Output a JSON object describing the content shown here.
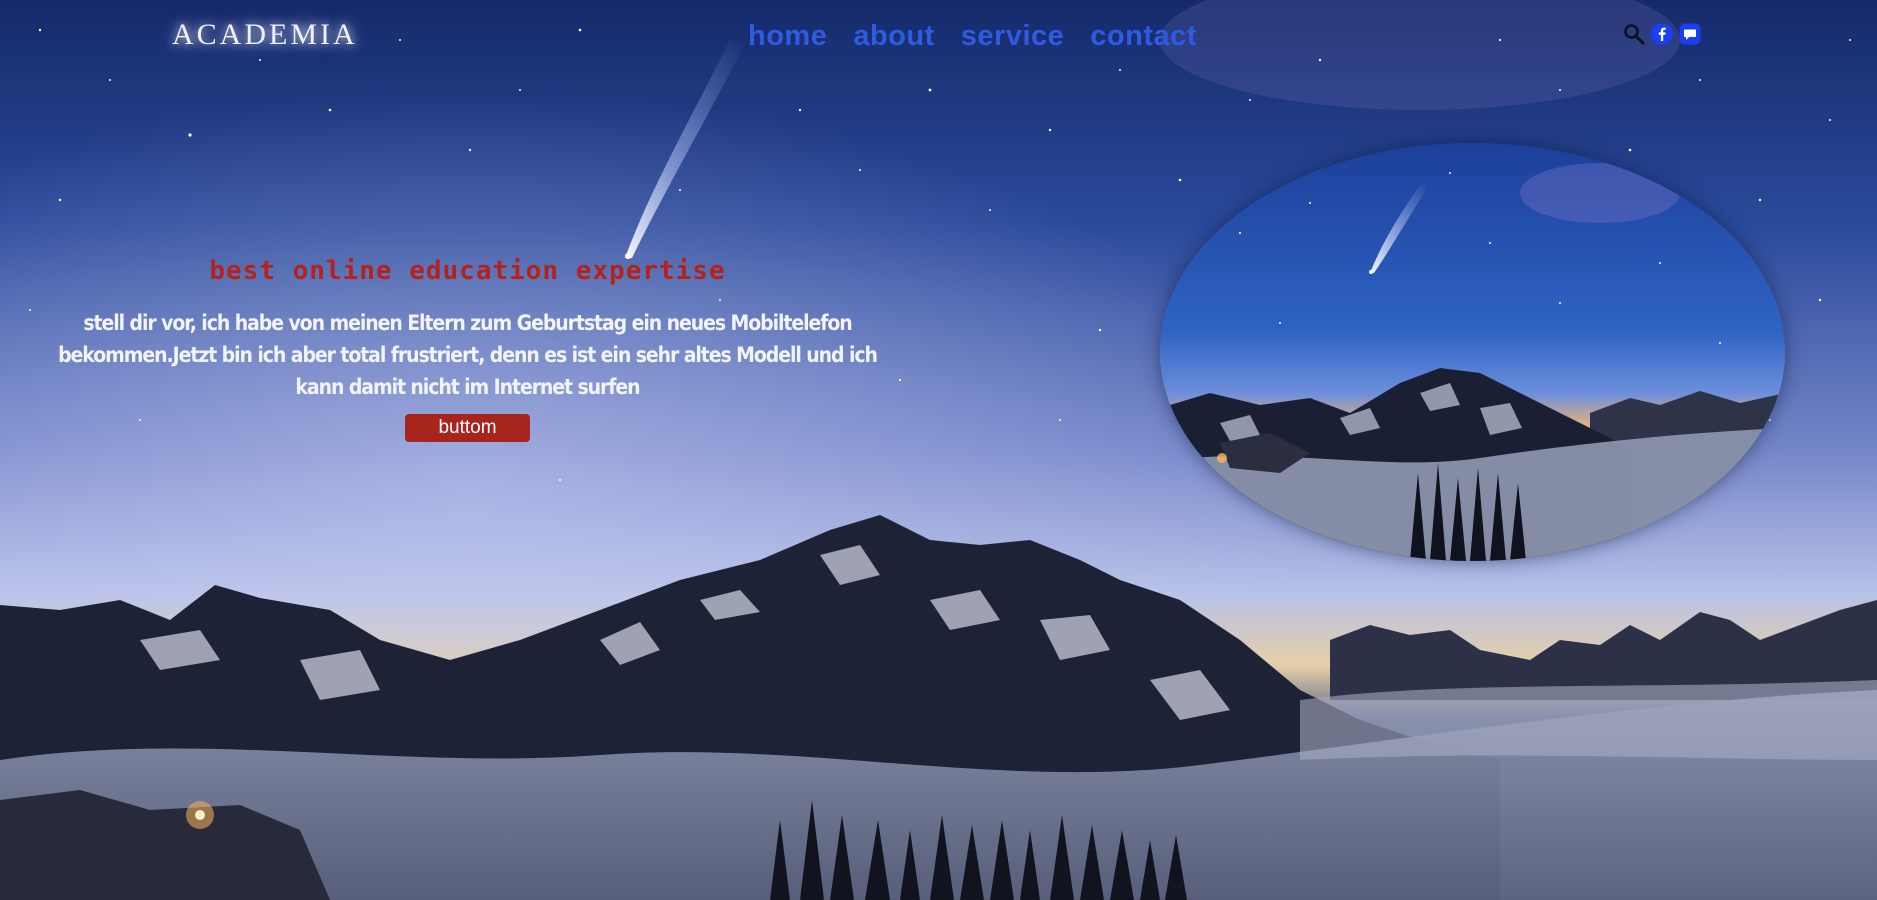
{
  "header": {
    "logo": "ACADEMIA",
    "nav": [
      {
        "label": "home"
      },
      {
        "label": "about"
      },
      {
        "label": "service"
      },
      {
        "label": "contact"
      }
    ],
    "icons": [
      "search-icon",
      "facebook-icon",
      "chat-icon"
    ]
  },
  "hero": {
    "tagline": "best online education expertise",
    "description": "stell dir vor, ich habe von meinen Eltern zum Geburtstag ein neues Mobiltelefon bekommen.Jetzt bin ich aber total frustriert, denn es ist ein sehr altes Modell und ich kann damit nicht im Internet surfen",
    "button_label": "buttom"
  },
  "colors": {
    "nav": "#2f5be0",
    "tagline": "#b5221c",
    "button": "#a8251e",
    "icons": "#1b3ef0"
  }
}
